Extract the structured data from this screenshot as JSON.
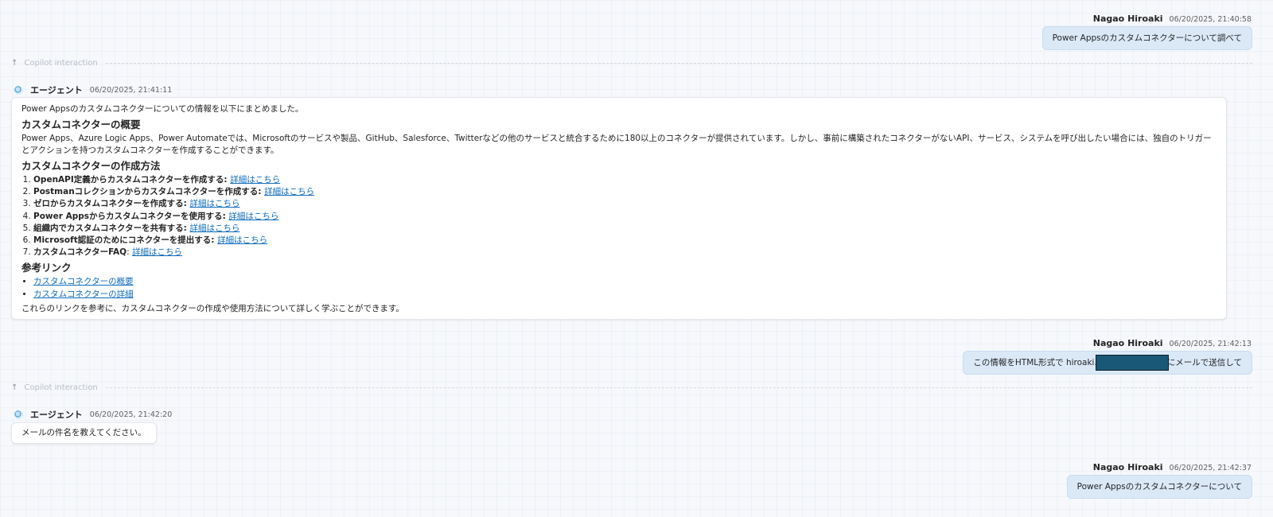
{
  "messages": {
    "m1": {
      "user": "Nagao Hiroaki",
      "time": "06/20/2025, 21:40:58",
      "text": "Power Appsのカスタムコネクターについて調べて"
    },
    "copilot_label": "Copilot interaction",
    "a1": {
      "agent": "エージェント",
      "time": "06/20/2025, 21:41:11",
      "intro": "Power Appsのカスタムコネクターについての情報を以下にまとめました。",
      "h_overview": "カスタムコネクターの概要",
      "overview": "Power Apps、Azure Logic Apps、Power Automateでは、Microsoftのサービスや製品、GitHub、Salesforce、Twitterなどの他のサービスと統合するために180以上のコネクターが提供されています。しかし、事前に構築されたコネクターがないAPI、サービス、システムを呼び出したい場合には、独自のトリガーとアクションを持つカスタムコネクターを作成することができます。",
      "h_howto": "カスタムコネクターの作成方法",
      "steps": [
        {
          "label": "OpenAPI定義からカスタムコネクターを作成する",
          "link": "詳細はこちら"
        },
        {
          "label": "Postmanコレクションからカスタムコネクターを作成する",
          "link": "詳細はこちら"
        },
        {
          "label": "ゼロからカスタムコネクターを作成する",
          "link": "詳細はこちら"
        },
        {
          "label": "Power Appsからカスタムコネクターを使用する",
          "link": "詳細はこちら"
        },
        {
          "label": "組織内でカスタムコネクターを共有する",
          "link": "詳細はこちら"
        },
        {
          "label": "Microsoft認証のためにコネクターを提出する",
          "link": "詳細はこちら"
        },
        {
          "label": "カスタムコネクターFAQ",
          "link": "詳細はこちら"
        }
      ],
      "h_refs": "参考リンク",
      "refs": [
        "カスタムコネクターの概要",
        "カスタムコネクターの詳細"
      ],
      "outro": "これらのリンクを参考に、カスタムコネクターの作成や使用方法について詳しく学ぶことができます。"
    },
    "m2": {
      "user": "Nagao Hiroaki",
      "time": "06/20/2025, 21:42:13",
      "text_before": "この情報をHTML形式で hiroaki.",
      "text_after": "にメールで送信して"
    },
    "a2": {
      "agent": "エージェント",
      "time": "06/20/2025, 21:42:20",
      "text": "メールの件名を教えてください。"
    },
    "m3": {
      "user": "Nagao Hiroaki",
      "time": "06/20/2025, 21:42:37",
      "text": "Power Appsのカスタムコネクターについて"
    }
  },
  "colors": {
    "user_bubble": "#dbe9f7",
    "link": "#0f6cbd",
    "agent_bubble": "#ffffff"
  }
}
